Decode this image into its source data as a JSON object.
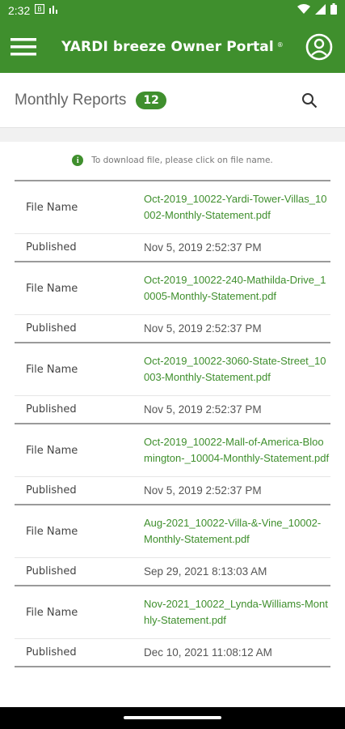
{
  "status_bar": {
    "time": "2:32",
    "icons": [
      "notification-icon",
      "chart-icon",
      "wifi-icon",
      "signal-icon",
      "battery-icon"
    ]
  },
  "app_bar": {
    "title": "YARDI breeze Owner Portal",
    "title_mark": "®",
    "menu_icon": "hamburger-menu-icon",
    "profile_icon": "account-circle-icon"
  },
  "header": {
    "title": "Monthly Reports",
    "count": "12",
    "search_icon": "search-icon"
  },
  "hint": {
    "text": "To download file, please click on file name.",
    "icon_glyph": "i"
  },
  "labels": {
    "file_name": "File Name",
    "published": "Published"
  },
  "reports": [
    {
      "file": "Oct-2019_10022-Yardi-Tower-Villas_10002-Monthly-Statement.pdf",
      "published": "Nov 5, 2019 2:52:37 PM"
    },
    {
      "file": "Oct-2019_10022-240-Mathilda-Drive_10005-Monthly-Statement.pdf",
      "published": "Nov 5, 2019 2:52:37 PM"
    },
    {
      "file": "Oct-2019_10022-3060-State-Street_10003-Monthly-Statement.pdf",
      "published": "Nov 5, 2019 2:52:37 PM"
    },
    {
      "file": "Oct-2019_10022-Mall-of-America-Bloomington-_10004-Monthly-Statement.pdf",
      "published": "Nov 5, 2019 2:52:37 PM"
    },
    {
      "file": "Aug-2021_10022-Villa-&-Vine_10002-Monthly-Statement.pdf",
      "published": "Sep 29, 2021 8:13:03 AM"
    },
    {
      "file": "Nov-2021_10022_Lynda-Williams-Monthly-Statement.pdf",
      "published": "Dec 10, 2021 11:08:12 AM"
    }
  ],
  "colors": {
    "brand_green": "#3f8f2d",
    "link_green": "#3f8f2d"
  }
}
